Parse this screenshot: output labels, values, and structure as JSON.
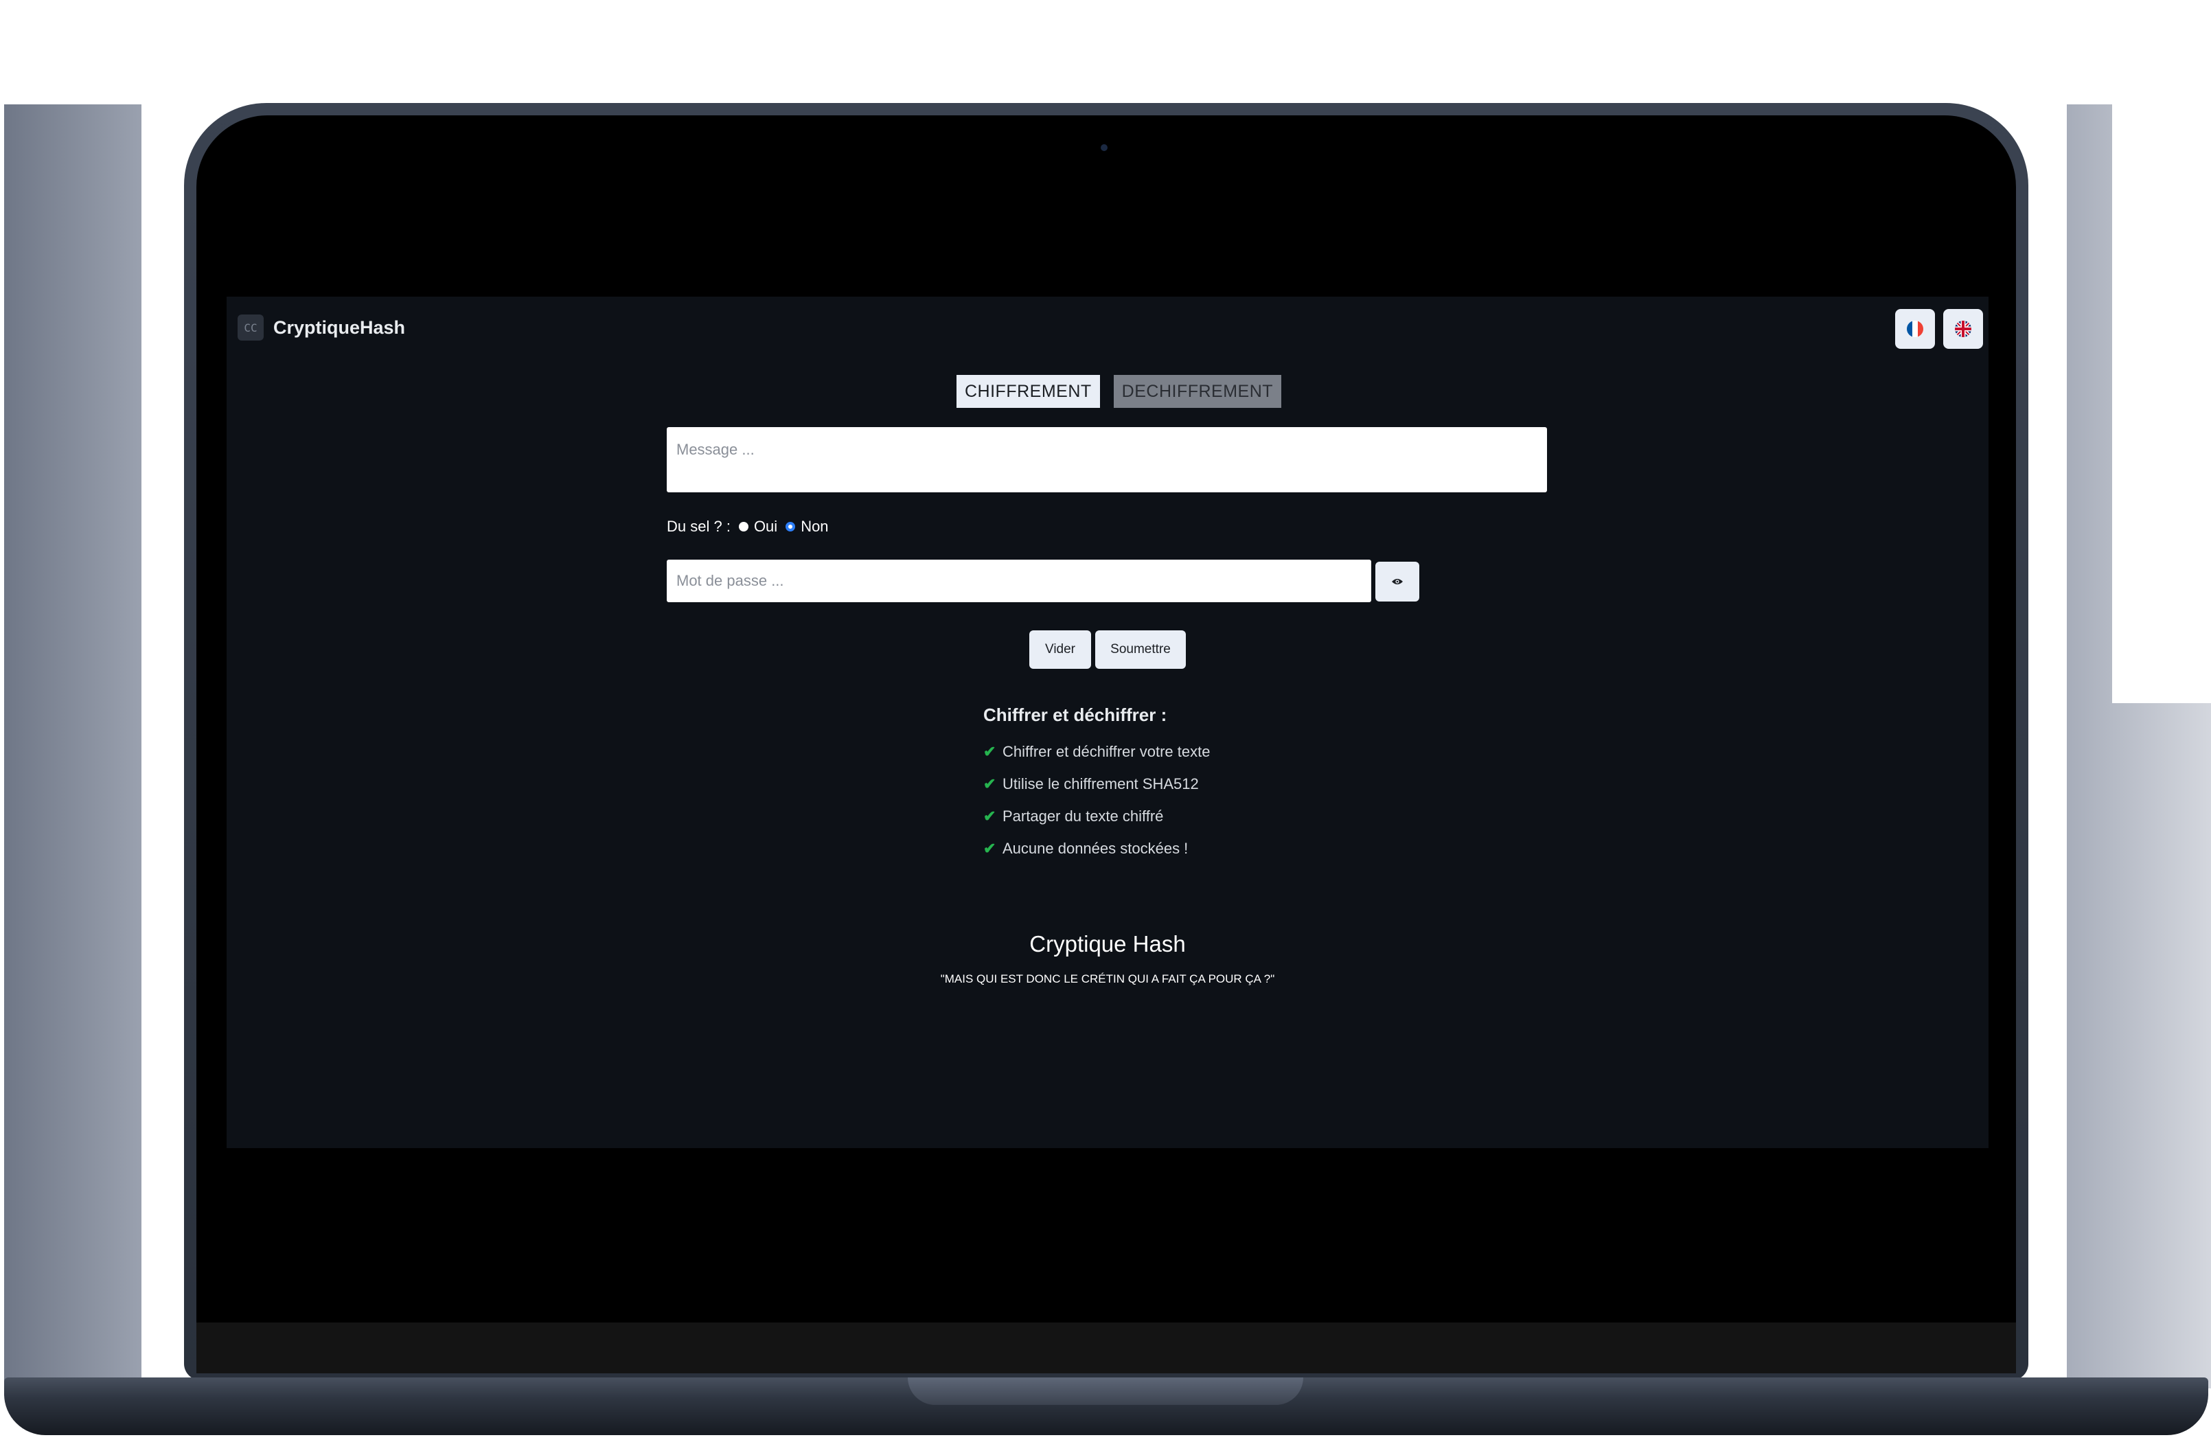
{
  "app": {
    "brand_logo_text": "CC",
    "brand_name": "CryptiqueHash"
  },
  "language": {
    "options": [
      {
        "code": "fr",
        "icon": "france-flag-icon"
      },
      {
        "code": "en",
        "icon": "uk-flag-icon"
      }
    ]
  },
  "tabs": [
    {
      "label": "CHIFFREMENT",
      "active": true
    },
    {
      "label": "DECHIFFREMENT",
      "active": false
    }
  ],
  "form": {
    "message_placeholder": "Message ...",
    "message_value": "",
    "salt_label": "Du sel ? :",
    "salt_options": [
      {
        "label": "Oui",
        "selected": false
      },
      {
        "label": "Non",
        "selected": true
      }
    ],
    "password_placeholder": "Mot de passe ...",
    "password_value": "",
    "toggle_visibility_icon": "eye-icon",
    "clear_label": "Vider",
    "submit_label": "Soumettre"
  },
  "features": {
    "title": "Chiffrer et déchiffrer :",
    "items": [
      "Chiffrer et déchiffrer votre texte",
      "Utilise le chiffrement SHA512",
      "Partager du texte chiffré",
      "Aucune données stockées !"
    ],
    "check_color": "#26b44f"
  },
  "footer": {
    "title": "Cryptique Hash",
    "quote": "\"MAIS QUI EST DONC LE CRÉTIN QUI A FAIT ÇA POUR ÇA ?\""
  },
  "colors": {
    "page_background": "#0d1117",
    "button_background": "#e9eef6",
    "inactive_tab": "#7b8089",
    "radio_selected": "#2d7ff9"
  }
}
